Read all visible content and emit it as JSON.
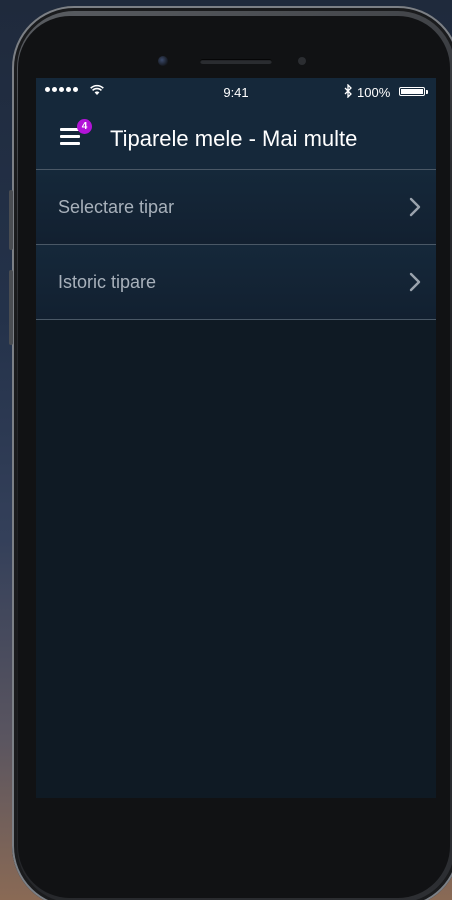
{
  "status_bar": {
    "time": "9:41",
    "battery": "100%",
    "battery_level": 1.0,
    "signal_bars": 5
  },
  "header": {
    "title": "Tiparele mele - Mai multe",
    "menu_badge": "4",
    "icon": "menu-icon"
  },
  "menu_items": [
    {
      "label": "Selectare tipar",
      "icon": "chevron-right-icon"
    },
    {
      "label": "Istoric tipare",
      "icon": "chevron-right-icon"
    }
  ],
  "colors": {
    "header_bg": "#15283a",
    "screen_bg": "#0f1a24",
    "badge": "#b214d8",
    "list_text": "#a8b1bb",
    "divider": "#4a5866"
  }
}
